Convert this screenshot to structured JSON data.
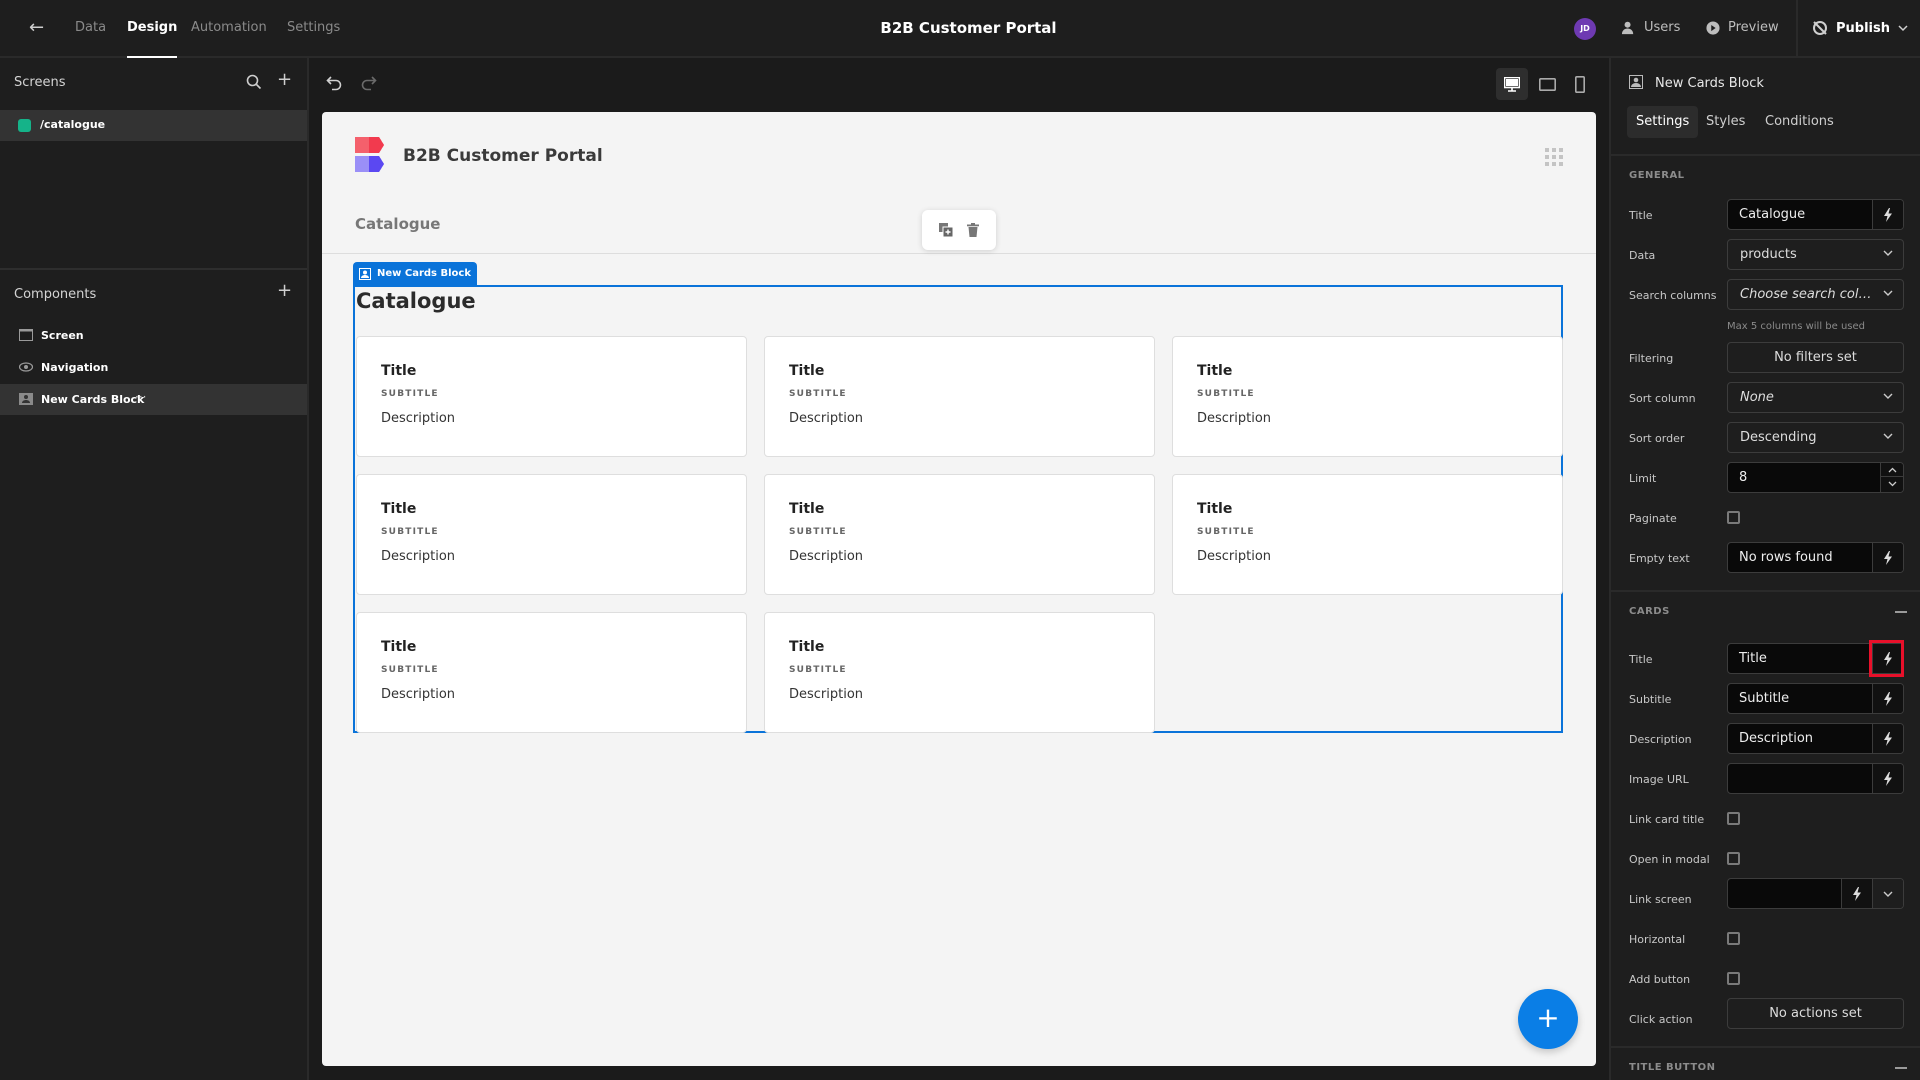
{
  "topbar": {
    "nav_tabs": [
      {
        "label": "Data",
        "active": false
      },
      {
        "label": "Design",
        "active": true
      },
      {
        "label": "Automation",
        "active": false
      },
      {
        "label": "Settings",
        "active": false
      }
    ],
    "app_title": "B2B Customer Portal",
    "avatar_initials": "JD",
    "users_label": "Users",
    "preview_label": "Preview",
    "publish_label": "Publish"
  },
  "left_panel": {
    "screens_heading": "Screens",
    "screens": [
      {
        "route": "/catalogue",
        "color": "#15b389",
        "selected": true
      }
    ],
    "components_heading": "Components",
    "components": [
      {
        "label": "Screen",
        "icon": "screen-icon",
        "selected": false
      },
      {
        "label": "Navigation",
        "icon": "eye-icon",
        "selected": false
      },
      {
        "label": "New Cards Block",
        "icon": "cards-block-icon",
        "selected": true,
        "more": "···"
      }
    ]
  },
  "canvas": {
    "brand_name": "B2B Customer Portal",
    "nav_link": "Catalogue",
    "block_tag": "New Cards Block",
    "block_title": "Catalogue",
    "cards": [
      {
        "title": "Title",
        "subtitle": "SUBTITLE",
        "description": "Description"
      },
      {
        "title": "Title",
        "subtitle": "SUBTITLE",
        "description": "Description"
      },
      {
        "title": "Title",
        "subtitle": "SUBTITLE",
        "description": "Description"
      },
      {
        "title": "Title",
        "subtitle": "SUBTITLE",
        "description": "Description"
      },
      {
        "title": "Title",
        "subtitle": "SUBTITLE",
        "description": "Description"
      },
      {
        "title": "Title",
        "subtitle": "SUBTITLE",
        "description": "Description"
      },
      {
        "title": "Title",
        "subtitle": "SUBTITLE",
        "description": "Description"
      },
      {
        "title": "Title",
        "subtitle": "SUBTITLE",
        "description": "Description"
      }
    ],
    "fab_label": "+",
    "accent_color": "#0a73d9"
  },
  "right_panel": {
    "component_name": "New Cards Block",
    "tabs": [
      {
        "label": "Settings",
        "active": true
      },
      {
        "label": "Styles",
        "active": false
      },
      {
        "label": "Conditions",
        "active": false
      }
    ],
    "general": {
      "heading": "GENERAL",
      "title_label": "Title",
      "title_value": "Catalogue",
      "data_label": "Data",
      "data_value": "products",
      "search_columns_label": "Search columns",
      "search_columns_placeholder": "Choose search colu…",
      "search_columns_hint": "Max 5 columns will be used",
      "filtering_label": "Filtering",
      "filtering_value": "No filters set",
      "sort_column_label": "Sort column",
      "sort_column_value": "None",
      "sort_order_label": "Sort order",
      "sort_order_value": "Descending",
      "limit_label": "Limit",
      "limit_value": "8",
      "paginate_label": "Paginate",
      "paginate_checked": false,
      "empty_text_label": "Empty text",
      "empty_text_value": "No rows found"
    },
    "cards": {
      "heading": "CARDS",
      "title_label": "Title",
      "title_value": "Title",
      "subtitle_label": "Subtitle",
      "subtitle_value": "Subtitle",
      "description_label": "Description",
      "description_value": "Description",
      "image_url_label": "Image URL",
      "image_url_value": "",
      "link_card_title_label": "Link card title",
      "link_card_title_checked": false,
      "open_in_modal_label": "Open in modal",
      "open_in_modal_checked": false,
      "link_screen_label": "Link screen",
      "link_screen_value": "",
      "horizontal_label": "Horizontal",
      "horizontal_checked": false,
      "add_button_label": "Add button",
      "add_button_checked": false,
      "click_action_label": "Click action",
      "click_action_value": "No actions set"
    },
    "title_button_heading": "TITLE BUTTON",
    "highlight_color": "#e8102a"
  }
}
